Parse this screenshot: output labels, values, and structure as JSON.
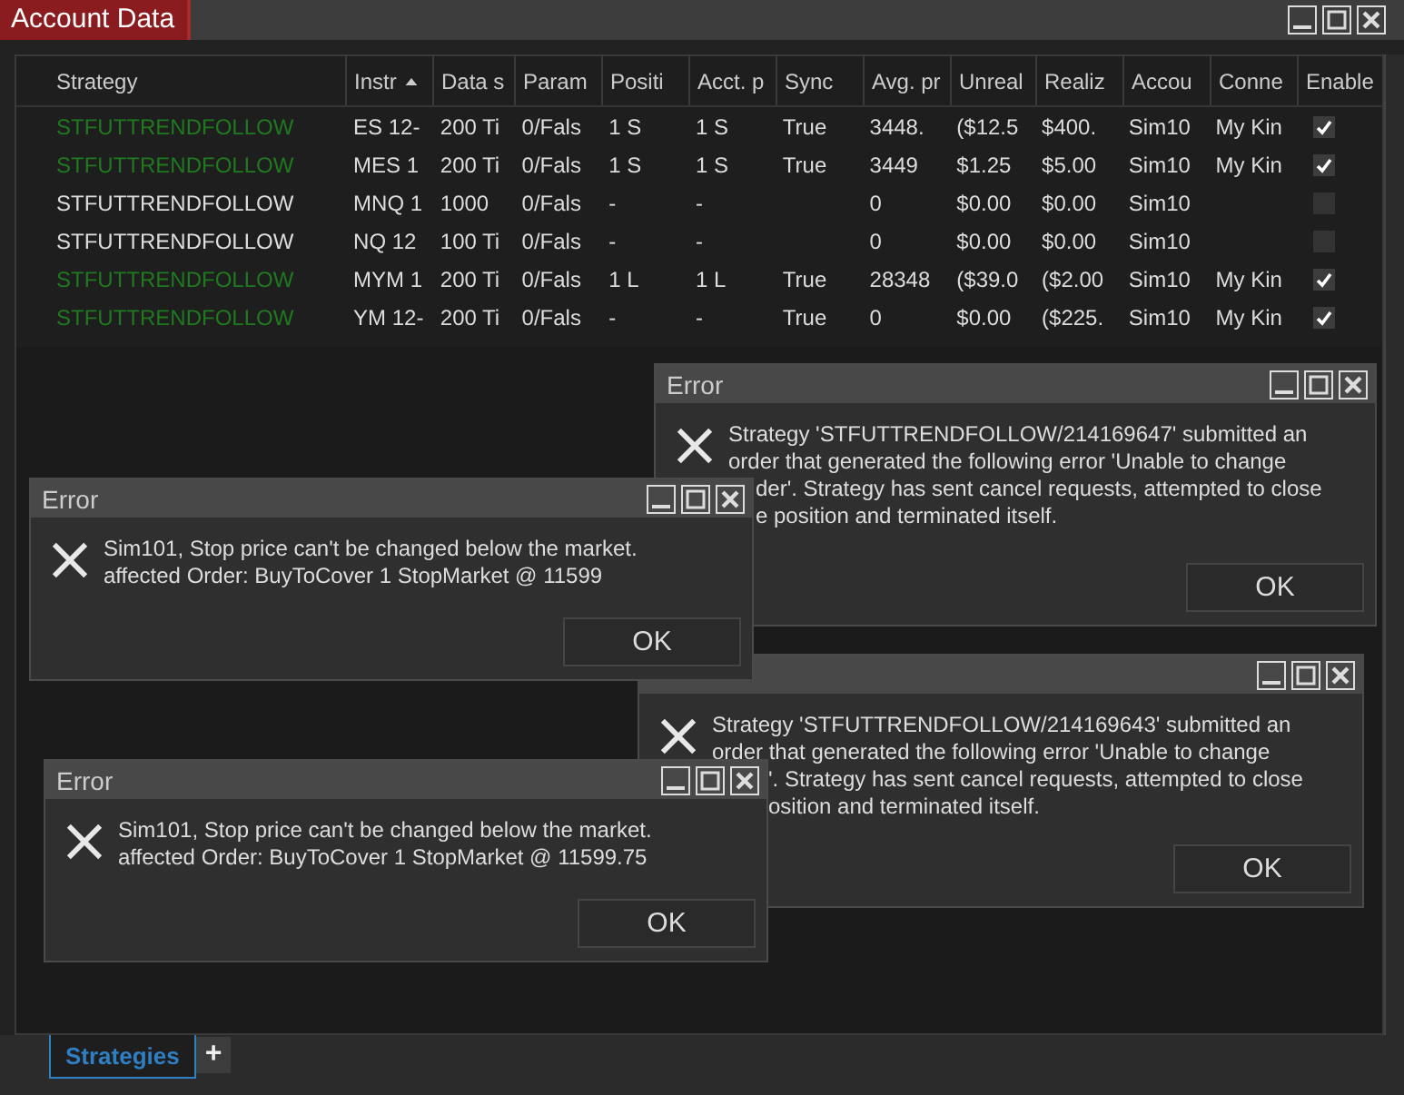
{
  "window": {
    "title": "Account Data"
  },
  "table": {
    "columns": [
      {
        "label": "Strategy",
        "sorted": false
      },
      {
        "label": "Instr",
        "sorted": true
      },
      {
        "label": "Data s",
        "sorted": false
      },
      {
        "label": "Param",
        "sorted": false
      },
      {
        "label": "Positi",
        "sorted": false
      },
      {
        "label": "Acct. p",
        "sorted": false
      },
      {
        "label": "Sync",
        "sorted": false
      },
      {
        "label": "Avg. pr",
        "sorted": false
      },
      {
        "label": "Unreal",
        "sorted": false
      },
      {
        "label": "Realiz",
        "sorted": false
      },
      {
        "label": "Accou",
        "sorted": false
      },
      {
        "label": "Conne",
        "sorted": false
      },
      {
        "label": "Enable",
        "sorted": false
      }
    ],
    "rows": [
      {
        "cells": [
          "STFUTTRENDFOLLOW",
          "ES 12-",
          "200 Ti",
          "0/Fals",
          "1 S",
          "1 S",
          "True",
          "3448.",
          "($12.5",
          "$400.",
          "Sim10",
          "My Kin"
        ],
        "enabled": true
      },
      {
        "cells": [
          "STFUTTRENDFOLLOW",
          "MES 1",
          "200 Ti",
          "0/Fals",
          "1 S",
          "1 S",
          "True",
          "3449",
          "$1.25",
          "$5.00",
          "Sim10",
          "My Kin"
        ],
        "enabled": true
      },
      {
        "cells": [
          "STFUTTRENDFOLLOW",
          "MNQ 1",
          "1000",
          "0/Fals",
          "-",
          "-",
          "",
          "0",
          "$0.00",
          "$0.00",
          "Sim10",
          ""
        ],
        "enabled": false
      },
      {
        "cells": [
          "STFUTTRENDFOLLOW",
          "NQ 12",
          "100 Ti",
          "0/Fals",
          "-",
          "-",
          "",
          "0",
          "$0.00",
          "$0.00",
          "Sim10",
          ""
        ],
        "enabled": false
      },
      {
        "cells": [
          "STFUTTRENDFOLLOW",
          "MYM 1",
          "200 Ti",
          "0/Fals",
          "1 L",
          "1 L",
          "True",
          "28348",
          "($39.0",
          "($2.00",
          "Sim10",
          "My Kin"
        ],
        "enabled": true
      },
      {
        "cells": [
          "STFUTTRENDFOLLOW",
          "YM 12-",
          "200 Ti",
          "0/Fals",
          "-",
          "-",
          "True",
          "0",
          "$0.00",
          "($225.",
          "Sim10",
          "My Kin"
        ],
        "enabled": true
      }
    ]
  },
  "dialogs": [
    {
      "title": "Error",
      "lines": [
        {
          "text": "Strategy 'STFUTTRENDFOLLOW/214169647' submitted an",
          "kind": "full"
        },
        {
          "text": "order that generated the following error 'Unable to change",
          "kind": "full"
        },
        {
          "text": "der'. Strategy has sent cancel requests, attempted to close",
          "kind": "clipped"
        },
        {
          "text": "e position and terminated itself.",
          "kind": "clipped"
        }
      ],
      "button": "OK"
    },
    {
      "title": "Error",
      "lines": [
        {
          "text": "Sim101, Stop price can't be changed below the market.",
          "kind": "full"
        },
        {
          "text": "affected Order: BuyToCover 1 StopMarket @ 11599",
          "kind": "full"
        }
      ],
      "button": "OK"
    },
    {
      "lines": [
        {
          "text": "Strategy 'STFUTTRENDFOLLOW/214169643' submitted an",
          "kind": "full"
        },
        {
          "text": "order that generated the following error 'Unable to change",
          "kind": "full"
        },
        {
          "text": "'. Strategy has sent cancel requests, attempted to close",
          "kind": "clipped"
        },
        {
          "text": "osition and terminated itself.",
          "kind": "clipped"
        }
      ],
      "button": "OK"
    },
    {
      "title": "Error",
      "lines": [
        {
          "text": "Sim101, Stop price can't be changed below the market.",
          "kind": "full"
        },
        {
          "text": "affected Order: BuyToCover 1 StopMarket @ 11599.75",
          "kind": "full"
        }
      ],
      "button": "OK"
    }
  ],
  "tabs": [
    {
      "label": "Strategies",
      "selected": true
    },
    {
      "label": "+",
      "selected": false
    }
  ]
}
